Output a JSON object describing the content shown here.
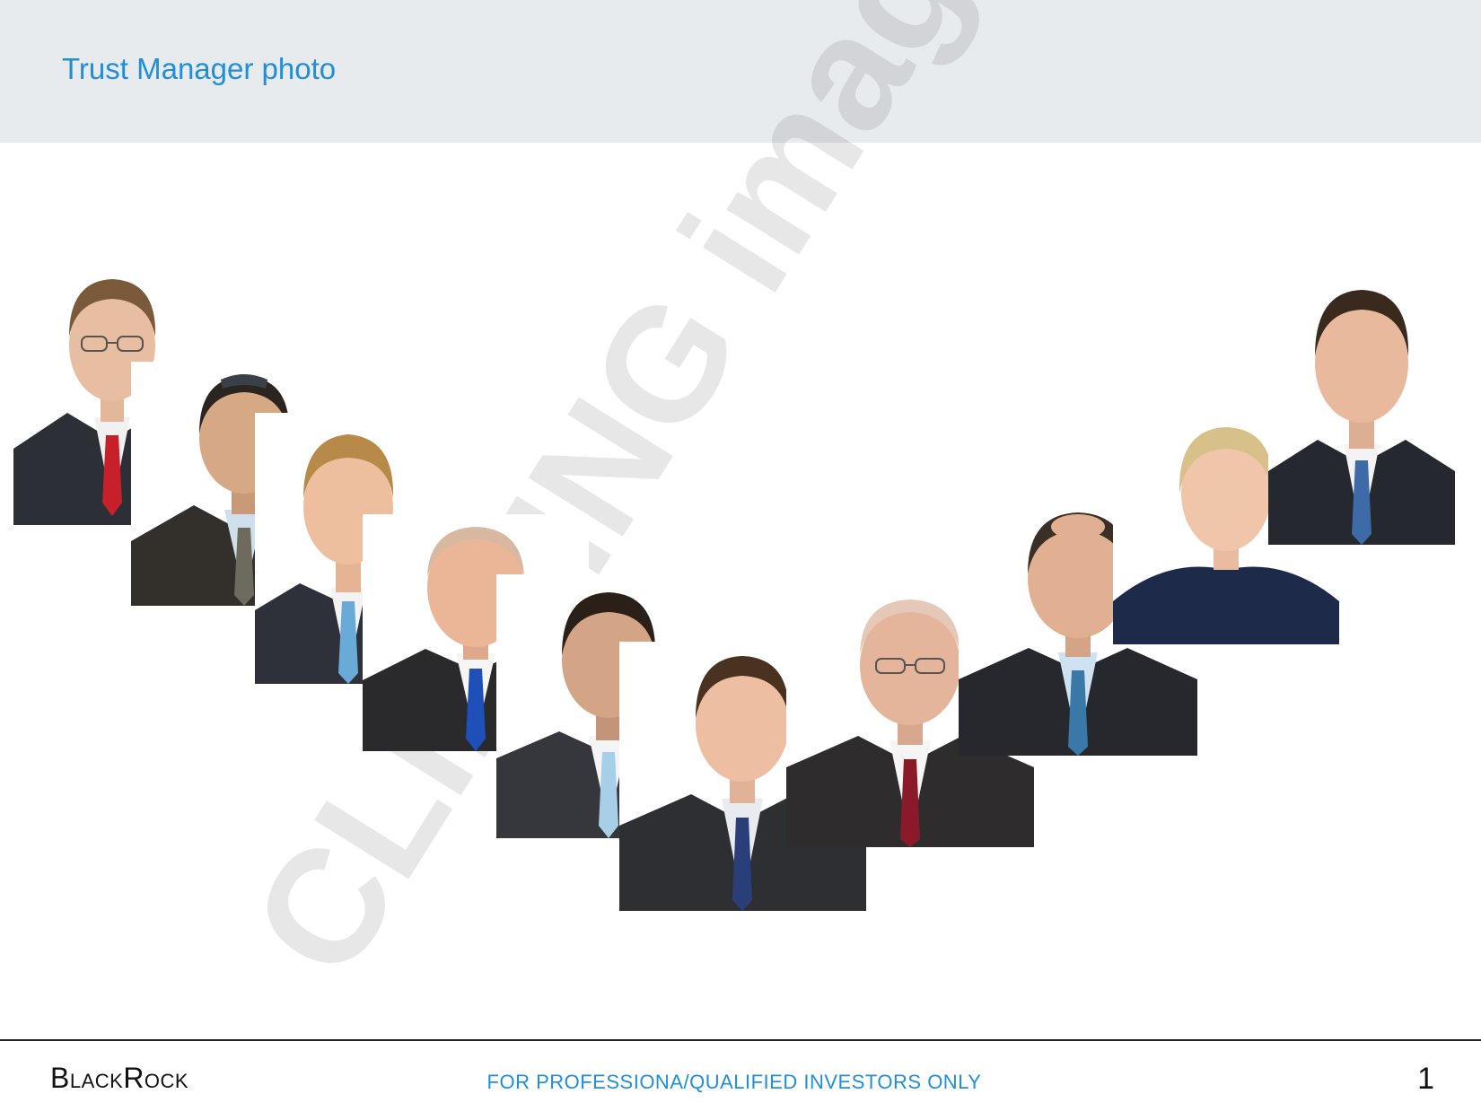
{
  "slide": {
    "title": "Trust Manager photo",
    "brand": "BlackRock",
    "disclaimer": "FOR PROFESSIONA/QUALIFIED INVESTORS ONLY",
    "page_number": "1"
  },
  "watermark": {
    "text": "CLIPPING images"
  },
  "photos": [
    {
      "id": "manager-1",
      "tie_color": "#c8202b",
      "hair_color": "#7a5a3a",
      "glasses": true
    },
    {
      "id": "manager-2",
      "tie_color": "#6f6a5e",
      "hair_color": "#2b2520",
      "glasses": false
    },
    {
      "id": "manager-3",
      "tie_color": "#6aaad8",
      "hair_color": "#b88a4a",
      "glasses": false
    },
    {
      "id": "manager-4",
      "tie_color": "#1f4fb8",
      "hair_color": "#d8b8a0",
      "glasses": false
    },
    {
      "id": "manager-5",
      "tie_color": "#a8cfe8",
      "hair_color": "#2a2018",
      "glasses": false
    },
    {
      "id": "manager-6",
      "tie_color": "#2a3f7a",
      "hair_color": "#4a3220",
      "glasses": false
    },
    {
      "id": "manager-7",
      "tie_color": "#8a1a2a",
      "hair_color": "#e6c8b8",
      "glasses": true
    },
    {
      "id": "manager-8",
      "tie_color": "#3a78a8",
      "hair_color": "#3a3028",
      "glasses": false
    },
    {
      "id": "manager-9",
      "tie_color": "#1e2a4a",
      "hair_color": "#d8c08a",
      "glasses": false
    },
    {
      "id": "manager-10",
      "tie_color": "#3f6aa8",
      "hair_color": "#3a2a1e",
      "glasses": false
    }
  ]
}
